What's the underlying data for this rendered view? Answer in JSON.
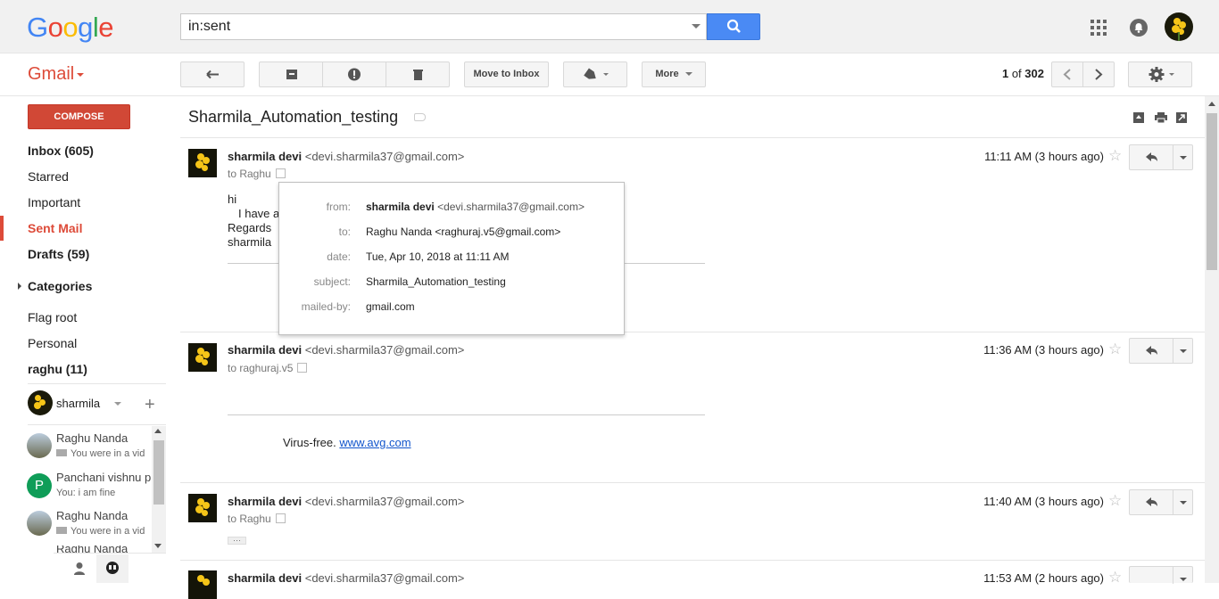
{
  "header": {
    "logo_text": "Google",
    "search_value": "in:sent",
    "accent": "#4285f4"
  },
  "toolbar": {
    "product": "Gmail",
    "move_to_inbox": "Move to Inbox",
    "more": "More",
    "pager_current": "1",
    "pager_of": "of",
    "pager_total": "302"
  },
  "sidebar": {
    "compose": "COMPOSE",
    "items": [
      {
        "label": "Inbox (605)"
      },
      {
        "label": "Starred"
      },
      {
        "label": "Important"
      },
      {
        "label": "Sent Mail"
      },
      {
        "label": "Drafts (59)"
      },
      {
        "label": "Categories"
      },
      {
        "label": "Flag root"
      },
      {
        "label": "Personal"
      },
      {
        "label": "raghu (11)"
      }
    ],
    "hangouts_user": "sharmila",
    "chats": [
      {
        "name": "Raghu Nanda",
        "preview": "You were in a vid"
      },
      {
        "name": "Panchani vishnu p",
        "preview": "You: i am fine",
        "initial": "P"
      },
      {
        "name": "Raghu Nanda",
        "preview": "You were in a vid"
      },
      {
        "name": "Raghu Nanda"
      }
    ]
  },
  "thread": {
    "subject": "Sharmila_Automation_testing",
    "messages": [
      {
        "sender": "sharmila devi",
        "email": "<devi.sharmila37@gmail.com>",
        "to": "to Raghu",
        "time": "11:11 AM (3 hours ago)",
        "body": [
          "hi",
          "I have a",
          "Regards",
          "sharmila"
        ]
      },
      {
        "sender": "sharmila devi",
        "email": "<devi.sharmila37@gmail.com>",
        "to": "to raghuraj.v5",
        "time": "11:36 AM (3 hours ago)",
        "virus_free": "Virus-free.",
        "link": "www.avg.com"
      },
      {
        "sender": "sharmila devi",
        "email": "<devi.sharmila37@gmail.com>",
        "to": "to Raghu",
        "time": "11:40 AM (3 hours ago)",
        "ellipsis": "···"
      },
      {
        "sender": "sharmila devi",
        "email": "<devi.sharmila37@gmail.com>",
        "time": "11:53 AM (2 hours ago)"
      }
    ]
  },
  "popup": {
    "from_label": "from:",
    "from_name": "sharmila devi",
    "from_email": "<devi.sharmila37@gmail.com>",
    "to_label": "to:",
    "to_value": "Raghu Nanda <raghuraj.v5@gmail.com>",
    "date_label": "date:",
    "date_value": "Tue, Apr 10, 2018 at 11:11 AM",
    "subject_label": "subject:",
    "subject_value": "Sharmila_Automation_testing",
    "mailedby_label": "mailed-by:",
    "mailedby_value": "gmail.com"
  }
}
